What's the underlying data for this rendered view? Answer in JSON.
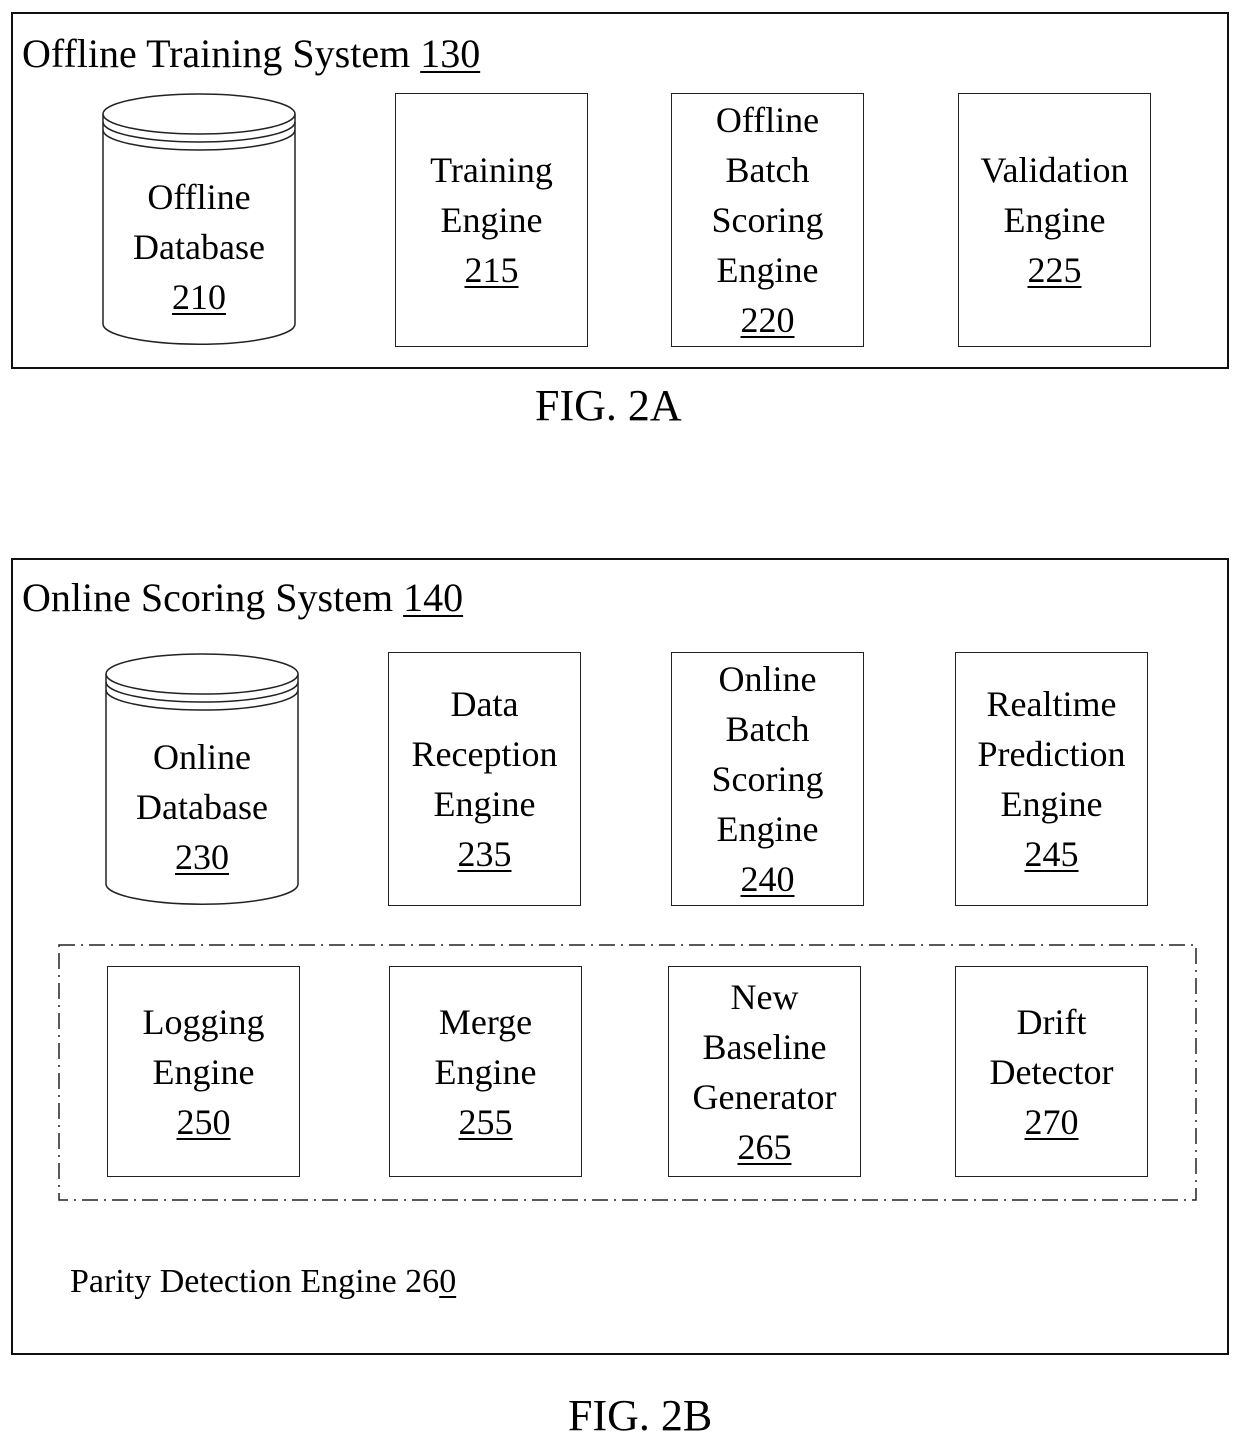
{
  "fig2a": {
    "system_title": "Offline Training System ",
    "system_ref": "130",
    "database": {
      "lines": [
        "Offline",
        "Database"
      ],
      "ref": "210"
    },
    "components": [
      {
        "lines": [
          "Training",
          "Engine"
        ],
        "ref": "215"
      },
      {
        "lines": [
          "Offline",
          "Batch",
          "Scoring",
          "Engine"
        ],
        "ref": "220"
      },
      {
        "lines": [
          "Validation",
          "Engine"
        ],
        "ref": "225"
      }
    ],
    "caption": "FIG. 2A"
  },
  "fig2b": {
    "system_title": "Online Scoring System ",
    "system_ref": "140",
    "database": {
      "lines": [
        "Online",
        "Database"
      ],
      "ref": "230"
    },
    "components": [
      {
        "lines": [
          "Data",
          "Reception",
          "Engine"
        ],
        "ref": "235"
      },
      {
        "lines": [
          "Online",
          "Batch",
          "Scoring",
          "Engine"
        ],
        "ref": "240"
      },
      {
        "lines": [
          "Realtime",
          "Prediction",
          "Engine"
        ],
        "ref": "245"
      }
    ],
    "parity_components": [
      {
        "lines": [
          "Logging",
          "Engine"
        ],
        "ref": "250"
      },
      {
        "lines": [
          "Merge",
          "Engine"
        ],
        "ref": "255"
      },
      {
        "lines": [
          "New",
          "Baseline",
          "Generator"
        ],
        "ref": "265"
      },
      {
        "lines": [
          "Drift",
          "Detector"
        ],
        "ref": "270"
      }
    ],
    "parity_label_prefix": "Parity Detection Engine 26",
    "parity_label_underlined": "0",
    "caption": "FIG. 2B"
  }
}
